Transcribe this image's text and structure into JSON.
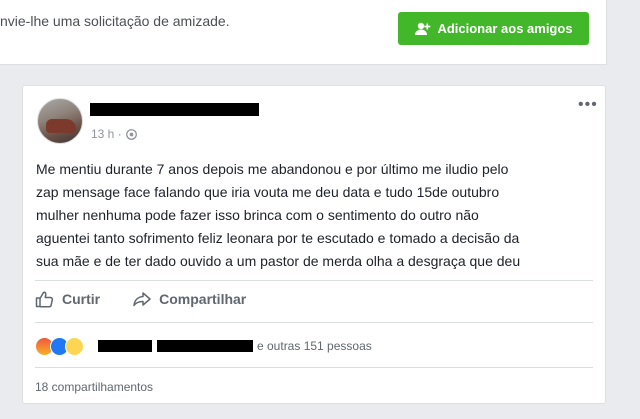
{
  "banner": {
    "text": "nvie-lhe uma solicitação de amizade.",
    "add_friends_label": "Adicionar aos amigos",
    "accent": "#42b72a"
  },
  "post": {
    "time": "13 h ·",
    "text": "Me mentiu durante 7 anos depois me abandonou e por último me iludio pelo\nzap mensage face falando que iria vouta me deu data e tudo 15de outubro\nmulher nenhuma pode fazer isso brinca com o sentimento do outro não\naguentei tanto sofrimento feliz leonara por te escutado e tomado a decisão da\nsua mãe e de ter dado ouvido a um pastor de merda olha a desgraça que deu",
    "actions": {
      "like_label": "Curtir",
      "share_label": "Compartilhar"
    },
    "reactions": {
      "icons": [
        "angry-icon",
        "like-icon",
        "wow-icon"
      ],
      "others_text": "e outras 151 pessoas"
    },
    "shares_text": "18 compartilhamentos"
  }
}
